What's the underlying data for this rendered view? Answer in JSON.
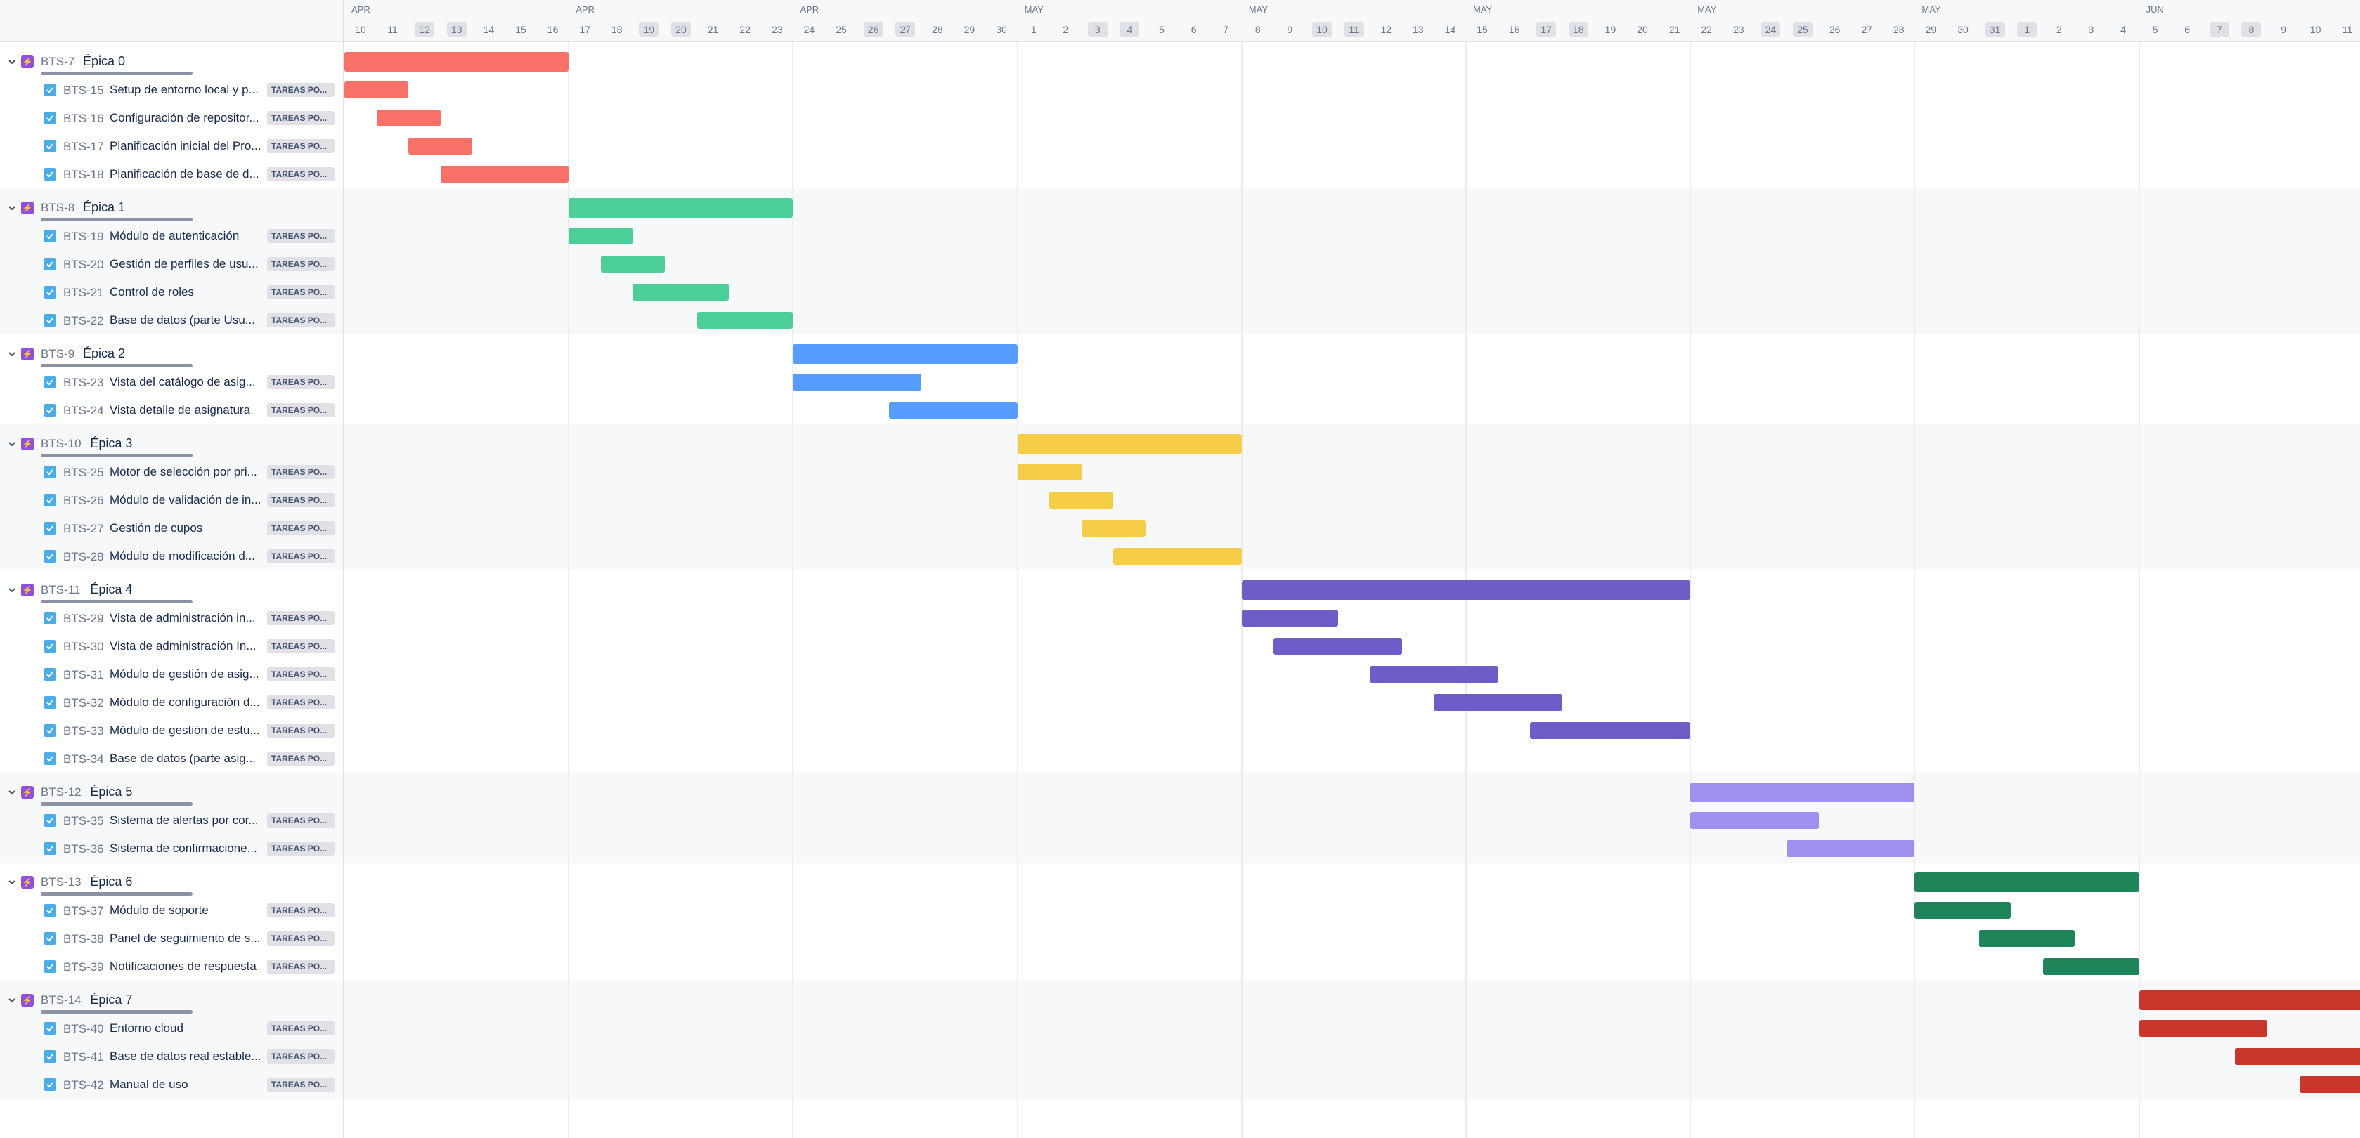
{
  "timeline": {
    "months": [
      {
        "label": "APR",
        "day": 10
      },
      {
        "label": "APR",
        "day": 17
      },
      {
        "label": "APR",
        "day": 24
      },
      {
        "label": "MAY",
        "day": 1
      },
      {
        "label": "MAY",
        "day": 8
      },
      {
        "label": "MAY",
        "day": 15
      },
      {
        "label": "MAY",
        "day": 22
      },
      {
        "label": "MAY",
        "day": 29
      },
      {
        "label": "JUN",
        "day": 5
      }
    ],
    "days": [
      "10",
      "11",
      "12",
      "13",
      "14",
      "15",
      "16",
      "17",
      "18",
      "19",
      "20",
      "21",
      "22",
      "23",
      "24",
      "25",
      "26",
      "27",
      "28",
      "29",
      "30",
      "1",
      "2",
      "3",
      "4",
      "5",
      "6",
      "7",
      "8",
      "9",
      "10",
      "11",
      "12",
      "13",
      "14",
      "15",
      "16",
      "17",
      "18",
      "19",
      "20",
      "21",
      "22",
      "23",
      "24",
      "25",
      "26",
      "27",
      "28",
      "29",
      "30",
      "31",
      "1",
      "2",
      "3",
      "4",
      "5",
      "6",
      "7",
      "8",
      "9",
      "10",
      "11"
    ],
    "weekend_indices": [
      2,
      3,
      9,
      10,
      16,
      17,
      23,
      24,
      30,
      31,
      37,
      38,
      44,
      45,
      51,
      52,
      58,
      59
    ]
  },
  "status_label": "TAREAS PO...",
  "epics": [
    {
      "key": "BTS-7",
      "name": "Épica 0",
      "color": "#f87168",
      "start": 0,
      "end": 7,
      "tasks": [
        {
          "key": "BTS-15",
          "name": "Setup de entorno local y p...",
          "start": 0,
          "end": 2
        },
        {
          "key": "BTS-16",
          "name": "Configuración de repositor...",
          "start": 1,
          "end": 3
        },
        {
          "key": "BTS-17",
          "name": "Planificación inicial del Pro...",
          "start": 2,
          "end": 4
        },
        {
          "key": "BTS-18",
          "name": "Planificación de base de d...",
          "start": 3,
          "end": 7
        }
      ]
    },
    {
      "key": "BTS-8",
      "name": "Épica 1",
      "color": "#4bce97",
      "start": 7,
      "end": 14,
      "tasks": [
        {
          "key": "BTS-19",
          "name": "Módulo de autenticación",
          "start": 7,
          "end": 9
        },
        {
          "key": "BTS-20",
          "name": "Gestión de perfiles de usu...",
          "start": 8,
          "end": 10
        },
        {
          "key": "BTS-21",
          "name": "Control de roles",
          "start": 9,
          "end": 12
        },
        {
          "key": "BTS-22",
          "name": "Base de datos (parte Usu...",
          "start": 11,
          "end": 14
        }
      ]
    },
    {
      "key": "BTS-9",
      "name": "Épica 2",
      "color": "#579dff",
      "start": 14,
      "end": 21,
      "tasks": [
        {
          "key": "BTS-23",
          "name": "Vista del catálogo de asig...",
          "start": 14,
          "end": 18
        },
        {
          "key": "BTS-24",
          "name": "Vista detalle de asignatura",
          "start": 17,
          "end": 21
        }
      ]
    },
    {
      "key": "BTS-10",
      "name": "Épica 3",
      "color": "#f5cd47",
      "start": 21,
      "end": 28,
      "tasks": [
        {
          "key": "BTS-25",
          "name": "Motor de selección por pri...",
          "start": 21,
          "end": 23
        },
        {
          "key": "BTS-26",
          "name": "Módulo de validación de in...",
          "start": 22,
          "end": 24
        },
        {
          "key": "BTS-27",
          "name": "Gestión de cupos",
          "start": 23,
          "end": 25
        },
        {
          "key": "BTS-28",
          "name": "Módulo de modificación d...",
          "start": 24,
          "end": 28
        }
      ]
    },
    {
      "key": "BTS-11",
      "name": "Épica 4",
      "color": "#6e5dc6",
      "start": 28,
      "end": 42,
      "tasks": [
        {
          "key": "BTS-29",
          "name": "Vista de administración in...",
          "start": 28,
          "end": 31
        },
        {
          "key": "BTS-30",
          "name": "Vista de administración In...",
          "start": 29,
          "end": 33
        },
        {
          "key": "BTS-31",
          "name": "Módulo de gestión de asig...",
          "start": 32,
          "end": 36
        },
        {
          "key": "BTS-32",
          "name": "Módulo de configuración d...",
          "start": 34,
          "end": 38
        },
        {
          "key": "BTS-33",
          "name": "Módulo de gestión de estu...",
          "start": 37,
          "end": 42
        },
        {
          "key": "BTS-34",
          "name": "Base de datos (parte asig...",
          "start": null,
          "end": null
        }
      ]
    },
    {
      "key": "BTS-12",
      "name": "Épica 5",
      "color": "#9f8fef",
      "start": 42,
      "end": 49,
      "tasks": [
        {
          "key": "BTS-35",
          "name": "Sistema de alertas por cor...",
          "start": 42,
          "end": 46
        },
        {
          "key": "BTS-36",
          "name": "Sistema de confirmacione...",
          "start": 45,
          "end": 49
        }
      ]
    },
    {
      "key": "BTS-13",
      "name": "Épica 6",
      "color": "#1f845a",
      "start": 49,
      "end": 56,
      "tasks": [
        {
          "key": "BTS-37",
          "name": "Módulo de soporte",
          "start": 49,
          "end": 52
        },
        {
          "key": "BTS-38",
          "name": "Panel de seguimiento de s...",
          "start": 51,
          "end": 54
        },
        {
          "key": "BTS-39",
          "name": "Notificaciones de respuesta",
          "start": 53,
          "end": 56
        }
      ]
    },
    {
      "key": "BTS-14",
      "name": "Épica 7",
      "color": "#c9372c",
      "start": 56,
      "end": 64,
      "tasks": [
        {
          "key": "BTS-40",
          "name": "Entorno cloud",
          "start": 56,
          "end": 60
        },
        {
          "key": "BTS-41",
          "name": "Base de datos real estable...",
          "start": 59,
          "end": 63
        },
        {
          "key": "BTS-42",
          "name": "Manual de uso",
          "start": 61,
          "end": 64
        }
      ]
    }
  ]
}
